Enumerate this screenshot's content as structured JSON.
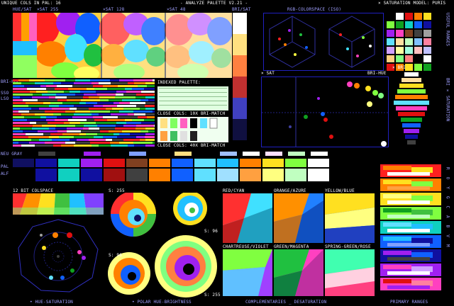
{
  "header": {
    "unique_cols": "UNIQUE COLS IN PAL: 16",
    "app_title": "- ANALYZE PALETTE V2.21 -",
    "sat_model": "× SATURATION MODEL: PURIS"
  },
  "top_labels": {
    "hue_sat_1": "HUE/SAT",
    "sat_255": "×SAT 255",
    "sat_128": "×SAT 128",
    "sat_48": "×SAT 48",
    "bri_vs_sat": "BRI/SAT",
    "rgb_space": "RGB-COLORSPACE (ISO)"
  },
  "left_labels": {
    "bri_vs_hue": "BRI-HUE",
    "sso": "SSO",
    "lso": "LSO",
    "neu_gray": "NEU GRAY",
    "pal": "PAL",
    "alf": "ALF"
  },
  "indexed": {
    "title": "INDEXED PALETTE:",
    "close_10": "CLOSE COLS: 10X BRI-MATCH",
    "close_40": "CLOSE COLS: 40X BRI-MATCH"
  },
  "mid_labels": {
    "sat": "× SAT",
    "bri_hue": "BRI-HUE",
    "bri": "× BRI"
  },
  "right_vertical": {
    "useful_ranges": "USEFUL RANGES",
    "bri_saturation": "BRI × SATURATION",
    "roygbiv": "ROYGCABVM"
  },
  "lower": {
    "colspace_12bit": "12 BIT COLSPACE",
    "s255": "S: 255",
    "s96a": "S: 96",
    "s96b": "S: 96",
    "s255b": "S: 255",
    "red_cyan": "RED/CYAN",
    "orange_azure": "ORANGE/AZURE",
    "yellow_blue": "YELLOW/BLUE",
    "chartreuse_violet": "CHARTREUSE/VIOLET",
    "green_magenta": "GREEN/MAGENTA",
    "spring_rose": "SPRING-GREEN/ROSE"
  },
  "footer": {
    "hue_saturation": "• HUE-SATURATION",
    "polar": "• POLAR HUE-BRIGHTNESS",
    "complementaries": "COMPLEMENTARIES _ DESATURATION",
    "primary_ranges": "PRIMARY RANGES"
  },
  "palette": [
    "#000000",
    "#ffffff",
    "#e01010",
    "#ff8000",
    "#ffe020",
    "#80ff40",
    "#10a020",
    "#10d0c0",
    "#1060ff",
    "#1010a0",
    "#a020f0",
    "#ff40c0",
    "#804020",
    "#404040",
    "#a0a0a0",
    "#60e0ff"
  ],
  "colors": {
    "frame": "#2020c0",
    "label": "#a0a0ff"
  }
}
